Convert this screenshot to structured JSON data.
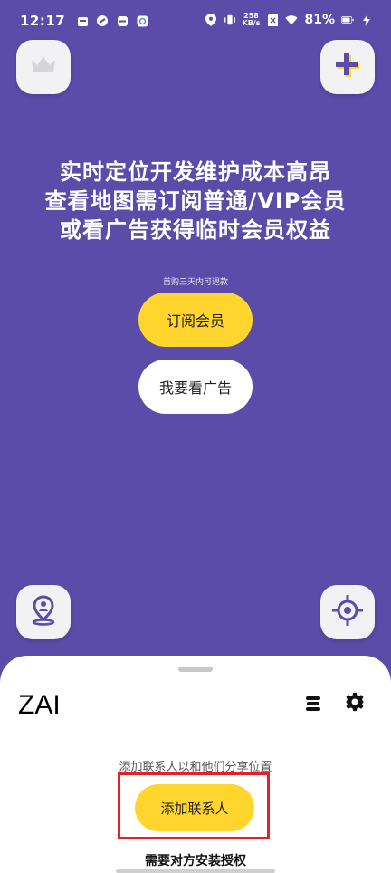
{
  "status_bar": {
    "time": "12:17",
    "speed_value": "258",
    "speed_unit": "KB/s",
    "battery": "81%"
  },
  "headline": {
    "line1": "实时定位开发维护成本高昂",
    "line2": "查看地图需订阅普通/VIP会员",
    "line3": "或看广告获得临时会员权益"
  },
  "refund_note": "首购三天内可退款",
  "buttons": {
    "subscribe": "订阅会员",
    "watch_ad": "我要看广告"
  },
  "sheet": {
    "title": "ZAI",
    "hint": "添加联系人以和他们分享位置",
    "add_contact": "添加联系人",
    "footer": "需要对方安装授权"
  },
  "colors": {
    "background": "#5a4ca8",
    "accent_yellow": "#ffd52e",
    "highlight_red": "#e5202a"
  },
  "icons": {
    "crown": "crown-icon",
    "add": "plus-icon",
    "user_location": "user-location-icon",
    "locate": "crosshair-icon",
    "menu": "menu-icon",
    "settings": "gear-icon"
  }
}
